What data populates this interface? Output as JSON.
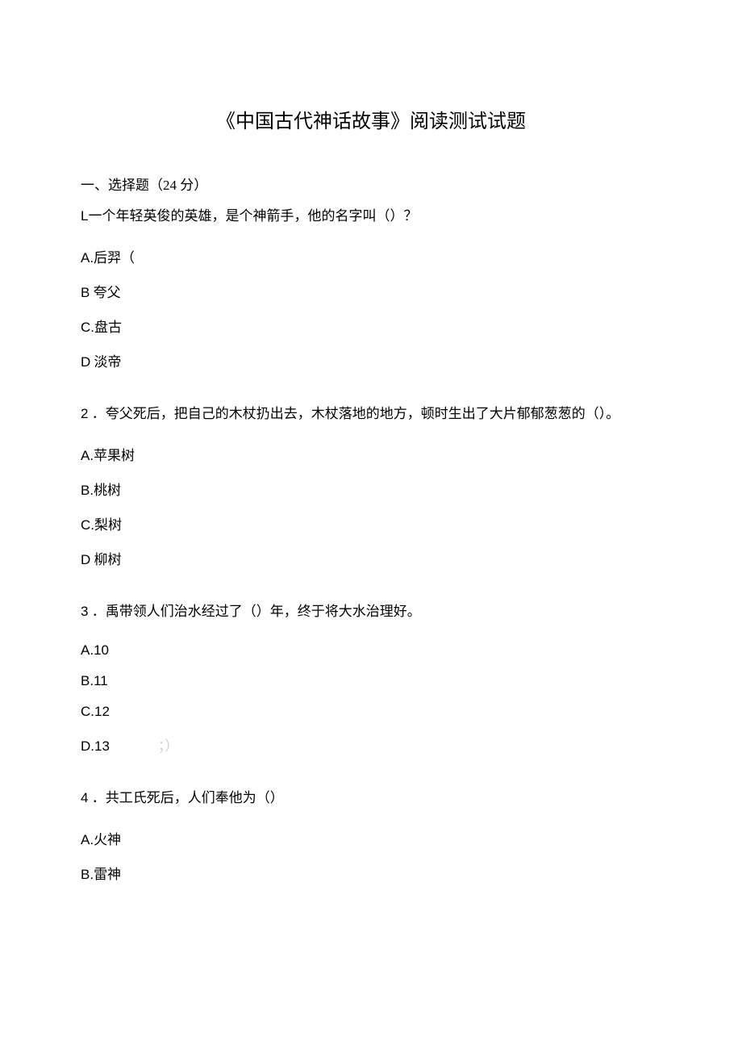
{
  "title": "《中国古代神话故事》阅读测试试题",
  "section": {
    "header": "一、选择题（24 分）"
  },
  "questions": {
    "q1": {
      "text_prefix": "L",
      "text": "一个年轻英俊的英雄，是个神箭手，他的名字叫（）？",
      "options": {
        "a_prefix": "A.",
        "a": "后羿（",
        "b_prefix": "B",
        "b": " 夸父",
        "c_prefix": "C.",
        "c": "盘古",
        "d_prefix": "D",
        "d": " 淡帝"
      }
    },
    "q2": {
      "number": "2",
      "text": " ．夸父死后，把自己的木杖扔出去，木杖落地的地方，顿时生出了大片郁郁葱葱的（）。",
      "options": {
        "a_prefix": "A.",
        "a": "苹果树",
        "b_prefix": "B.",
        "b": "桃树",
        "c_prefix": "C.",
        "c": "梨树",
        "d_prefix": "D",
        "d": " 柳树"
      }
    },
    "q3": {
      "number": "3",
      "text": " ．禹带领人们治水经过了（）年，终于将大水治理好。",
      "options": {
        "a_prefix": "A.",
        "a": "10",
        "b_prefix": "B.",
        "b": "11",
        "c_prefix": "C.",
        "c": "12",
        "d_prefix": "D.",
        "d": "13",
        "d_annotation": "；）"
      }
    },
    "q4": {
      "number": "4",
      "text": " ．共工氏死后，人们奉他为（）",
      "options": {
        "a_prefix": "A.",
        "a": "火神",
        "b_prefix": "B.",
        "b": "雷神"
      }
    }
  }
}
